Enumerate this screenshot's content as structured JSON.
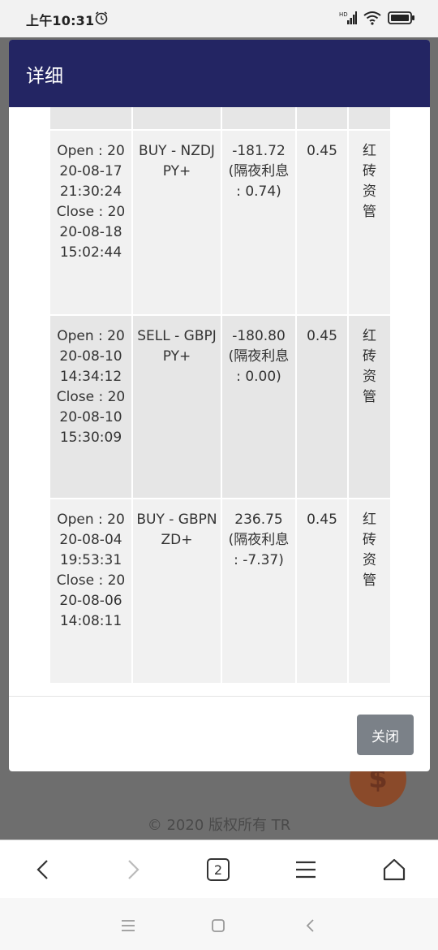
{
  "status_bar": {
    "time": "上午10:31",
    "icons": [
      "alarm-icon",
      "hd-signal-icon",
      "wifi-icon",
      "battery-icon"
    ]
  },
  "modal": {
    "title": "详细",
    "close_label": "关闭",
    "rows": [
      {
        "time": "Open : 2020-08-17 21:30:24 Close : 2020-08-18 15:02:44",
        "type": "BUY - NZDJPY+",
        "profit": "-181.72 (隔夜利息 : 0.74)",
        "lots": "0.45",
        "source": "红砖资管"
      },
      {
        "time": "Open : 2020-08-10 14:34:12 Close : 2020-08-10 15:30:09",
        "type": "SELL - GBPJPY+",
        "profit": "-180.80 (隔夜利息 : 0.00)",
        "lots": "0.45",
        "source": "红砖资管"
      },
      {
        "time": "Open : 2020-08-04 19:53:31 Close : 2020-08-06 14:08:11",
        "type": "BUY - GBPNZD+",
        "profit": "236.75 (隔夜利息 : -7.37)",
        "lots": "0.45",
        "source": "红砖资管"
      }
    ]
  },
  "background": {
    "copyright": "© 2020 版权所有 TR",
    "fab_icon": "dollar-icon"
  },
  "browser_nav": {
    "tab_count": "2",
    "icons": [
      "back-icon",
      "forward-icon",
      "tabs-icon",
      "menu-icon",
      "home-icon"
    ]
  },
  "system_nav": {
    "icons": [
      "recent-apps-icon",
      "home-square-icon",
      "system-back-icon"
    ]
  }
}
